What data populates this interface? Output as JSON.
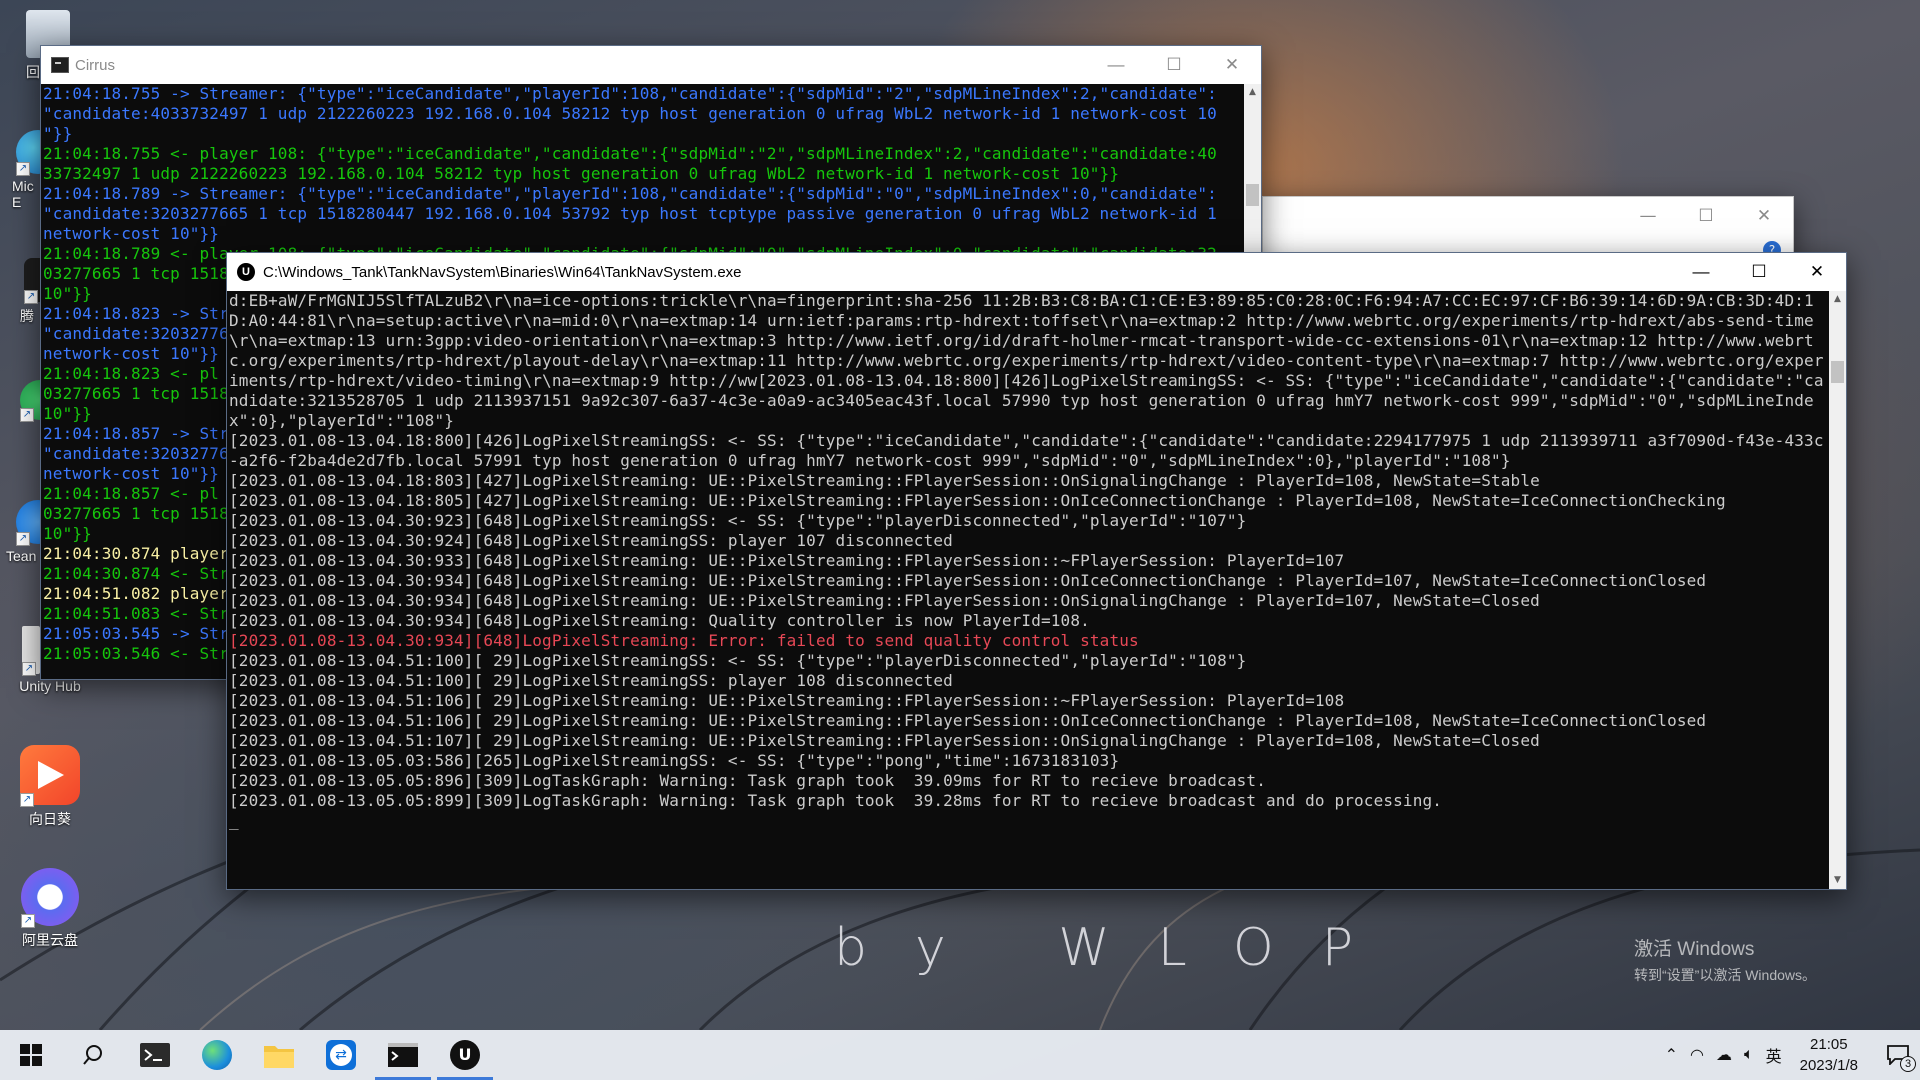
{
  "desktop": {
    "icons": [
      {
        "label": "回",
        "icon": "recycle-bin-icon"
      },
      {
        "label": "Mic\nE",
        "icon": "edge-icon"
      },
      {
        "label": "腾",
        "icon": "tencent-icon"
      },
      {
        "label": "",
        "icon": "green-app-icon"
      },
      {
        "label": "Tean",
        "icon": "teamviewer-icon"
      },
      {
        "label": "Unity Hub",
        "icon": "unity-hub-icon"
      },
      {
        "label": "向日葵",
        "icon": "sunlogin-icon"
      },
      {
        "label": "阿里云盘",
        "icon": "aliyun-drive-icon"
      }
    ],
    "watermark": "by WLOP",
    "activation": {
      "line1": "激活 Windows",
      "line2": "转到“设置”以激活 Windows。"
    }
  },
  "cirrus": {
    "title": "Cirrus",
    "lines": [
      {
        "c": "blue",
        "t": "21:04:18.755 -> Streamer: {\"type\":\"iceCandidate\",\"playerId\":108,\"candidate\":{\"sdpMid\":\"2\",\"sdpMLineIndex\":2,\"candidate\":"
      },
      {
        "c": "blue",
        "t": "\"candidate:4033732497 1 udp 2122260223 192.168.0.104 58212 typ host generation 0 ufrag WbL2 network-id 1 network-cost 10"
      },
      {
        "c": "blue",
        "t": "\"}}"
      },
      {
        "c": "green",
        "t": "21:04:18.755 <- player 108: {\"type\":\"iceCandidate\",\"candidate\":{\"sdpMid\":\"2\",\"sdpMLineIndex\":2,\"candidate\":\"candidate:40"
      },
      {
        "c": "green",
        "t": "33732497 1 udp 2122260223 192.168.0.104 58212 typ host generation 0 ufrag WbL2 network-id 1 network-cost 10\"}}"
      },
      {
        "c": "blue",
        "t": "21:04:18.789 -> Streamer: {\"type\":\"iceCandidate\",\"playerId\":108,\"candidate\":{\"sdpMid\":\"0\",\"sdpMLineIndex\":0,\"candidate\":"
      },
      {
        "c": "blue",
        "t": "\"candidate:3203277665 1 tcp 1518280447 192.168.0.104 53792 typ host tcptype passive generation 0 ufrag WbL2 network-id 1"
      },
      {
        "c": "blue",
        "t": "network-cost 10\"}}"
      },
      {
        "c": "green",
        "t": "21:04:18.789 <- player 108: {\"type\":\"iceCandidate\",\"candidate\":{\"sdpMid\":\"0\",\"sdpMLineIndex\":0,\"candidate\":\"candidate:32"
      },
      {
        "c": "green",
        "t": "03277665 1 tcp 1518"
      },
      {
        "c": "green",
        "t": "10\"}}"
      },
      {
        "c": "blue",
        "t": "21:04:18.823 -> Str"
      },
      {
        "c": "blue",
        "t": "\"candidate:32032776"
      },
      {
        "c": "blue",
        "t": "network-cost 10\"}}"
      },
      {
        "c": "green",
        "t": "21:04:18.823 <- pl"
      },
      {
        "c": "green",
        "t": "03277665 1 tcp 1518"
      },
      {
        "c": "green",
        "t": "10\"}}"
      },
      {
        "c": "blue",
        "t": "21:04:18.857 -> Str"
      },
      {
        "c": "blue",
        "t": "\"candidate:32032776"
      },
      {
        "c": "blue",
        "t": "network-cost 10\"}}"
      },
      {
        "c": "green",
        "t": "21:04:18.857 <- pl"
      },
      {
        "c": "green",
        "t": "03277665 1 tcp 1518"
      },
      {
        "c": "green",
        "t": "10\"}}"
      },
      {
        "c": "yellow",
        "t": "21:04:30.874 player"
      },
      {
        "c": "green",
        "t": "21:04:30.874 <- Str"
      },
      {
        "c": "yellow",
        "t": "21:04:51.082 player"
      },
      {
        "c": "green",
        "t": "21:04:51.083 <- Str"
      },
      {
        "c": "blue",
        "t": "21:05:03.545 -> Str"
      },
      {
        "c": "green",
        "t": "21:05:03.546 <- Str"
      }
    ]
  },
  "tank": {
    "title": "C:\\Windows_Tank\\TankNavSystem\\Binaries\\Win64\\TankNavSystem.exe",
    "lines": [
      {
        "c": "white",
        "t": "d:EB+aW/FrMGNIJ5SlfTALzuB2\\r\\na=ice-options:trickle\\r\\na=fingerprint:sha-256 11:2B:B3:C8:BA:C1:CE:E3:89:85:C0:28:0C:F6:94:A7:CC:EC:97:CF:B6:39:14:6D:9A:CB:3D:4D:1D:A0:44:81\\r\\na=setup:active\\r\\na=mid:0\\r\\na=extmap:14 urn:ietf:params:rtp-hdrext:toffset\\r\\na=extmap:2 http://www.webrtc.org/experiments/rtp-hdrext/abs-send-time\\r\\na=extmap:13 urn:3gpp:video-orientation\\r\\na=extmap:3 http://www.ietf.org/id/draft-holmer-rmcat-transport-wide-cc-extensions-01\\r\\na=extmap:12 http://www.webrtc.org/experiments/rtp-hdrext/playout-delay\\r\\na=extmap:11 http://www.webrtc.org/experiments/rtp-hdrext/video-content-type\\r\\na=extmap:7 http://www.webrtc.org/experiments/rtp-hdrext/video-timing\\r\\na=extmap:9 http://ww[2023.01.08-13.04.18:800][426]LogPixelStreamingSS: <- SS: {\"type\":\"iceCandidate\",\"candidate\":{\"candidate\":\"candidate:3213528705 1 udp 2113937151 9a92c307-6a37-4c3e-a0a9-ac3405eac43f.local 57990 typ host generation 0 ufrag hmY7 network-cost 999\",\"sdpMid\":\"0\",\"sdpMLineIndex\":0},\"playerId\":\"108\"}"
      },
      {
        "c": "white",
        "t": "[2023.01.08-13.04.18:800][426]LogPixelStreamingSS: <- SS: {\"type\":\"iceCandidate\",\"candidate\":{\"candidate\":\"candidate:2294177975 1 udp 2113939711 a3f7090d-f43e-433c-a2f6-f2ba4de2d7fb.local 57991 typ host generation 0 ufrag hmY7 network-cost 999\",\"sdpMid\":\"0\",\"sdpMLineIndex\":0},\"playerId\":\"108\"}"
      },
      {
        "c": "white",
        "t": "[2023.01.08-13.04.18:803][427]LogPixelStreaming: UE::PixelStreaming::FPlayerSession::OnSignalingChange : PlayerId=108, NewState=Stable"
      },
      {
        "c": "white",
        "t": "[2023.01.08-13.04.18:805][427]LogPixelStreaming: UE::PixelStreaming::FPlayerSession::OnIceConnectionChange : PlayerId=108, NewState=IceConnectionChecking"
      },
      {
        "c": "white",
        "t": "[2023.01.08-13.04.30:923][648]LogPixelStreamingSS: <- SS: {\"type\":\"playerDisconnected\",\"playerId\":\"107\"}"
      },
      {
        "c": "white",
        "t": "[2023.01.08-13.04.30:924][648]LogPixelStreamingSS: player 107 disconnected"
      },
      {
        "c": "white",
        "t": "[2023.01.08-13.04.30:933][648]LogPixelStreaming: UE::PixelStreaming::FPlayerSession::~FPlayerSession: PlayerId=107"
      },
      {
        "c": "white",
        "t": "[2023.01.08-13.04.30:934][648]LogPixelStreaming: UE::PixelStreaming::FPlayerSession::OnIceConnectionChange : PlayerId=107, NewState=IceConnectionClosed"
      },
      {
        "c": "white",
        "t": "[2023.01.08-13.04.30:934][648]LogPixelStreaming: UE::PixelStreaming::FPlayerSession::OnSignalingChange : PlayerId=107, NewState=Closed"
      },
      {
        "c": "white",
        "t": "[2023.01.08-13.04.30:934][648]LogPixelStreaming: Quality controller is now PlayerId=108."
      },
      {
        "c": "red",
        "t": "[2023.01.08-13.04.30:934][648]LogPixelStreaming: Error: failed to send quality control status"
      },
      {
        "c": "white",
        "t": "[2023.01.08-13.04.51:100][ 29]LogPixelStreamingSS: <- SS: {\"type\":\"playerDisconnected\",\"playerId\":\"108\"}"
      },
      {
        "c": "white",
        "t": "[2023.01.08-13.04.51:100][ 29]LogPixelStreamingSS: player 108 disconnected"
      },
      {
        "c": "white",
        "t": "[2023.01.08-13.04.51:106][ 29]LogPixelStreaming: UE::PixelStreaming::FPlayerSession::~FPlayerSession: PlayerId=108"
      },
      {
        "c": "white",
        "t": "[2023.01.08-13.04.51:106][ 29]LogPixelStreaming: UE::PixelStreaming::FPlayerSession::OnIceConnectionChange : PlayerId=108, NewState=IceConnectionClosed"
      },
      {
        "c": "white",
        "t": "[2023.01.08-13.04.51:107][ 29]LogPixelStreaming: UE::PixelStreaming::FPlayerSession::OnSignalingChange : PlayerId=108, NewState=Closed"
      },
      {
        "c": "white",
        "t": "[2023.01.08-13.05.03:586][265]LogPixelStreamingSS: <- SS: {\"type\":\"pong\",\"time\":1673183103}"
      },
      {
        "c": "white",
        "t": "[2023.01.08-13.05.05:896][309]LogTaskGraph: Warning: Task graph took  39.09ms for RT to recieve broadcast."
      },
      {
        "c": "white",
        "t": "[2023.01.08-13.05.05:899][309]LogTaskGraph: Warning: Task graph took  39.28ms for RT to recieve broadcast and do processing."
      }
    ],
    "cursor": "_"
  },
  "taskbar": {
    "apps": [
      {
        "name": "start-button",
        "icon": "windows-logo-icon"
      },
      {
        "name": "search-button",
        "icon": "search-icon"
      },
      {
        "name": "terminal-button",
        "icon": "terminal-icon"
      },
      {
        "name": "edge-button",
        "icon": "edge-icon"
      },
      {
        "name": "explorer-button",
        "icon": "folder-icon"
      },
      {
        "name": "teamviewer-button",
        "icon": "teamviewer-icon"
      },
      {
        "name": "cmd-button",
        "icon": "cmd-icon"
      },
      {
        "name": "unreal-button",
        "icon": "unreal-icon"
      }
    ],
    "tray": {
      "ime": "英",
      "time": "21:05",
      "date": "2023/1/8",
      "notifications": "3"
    }
  },
  "colors": {
    "blue": "#3b78ff",
    "green": "#16c60c",
    "yellow": "#f9f1a5",
    "white": "#cccccc",
    "red": "#e74856",
    "accent": "#3d7ad9"
  }
}
